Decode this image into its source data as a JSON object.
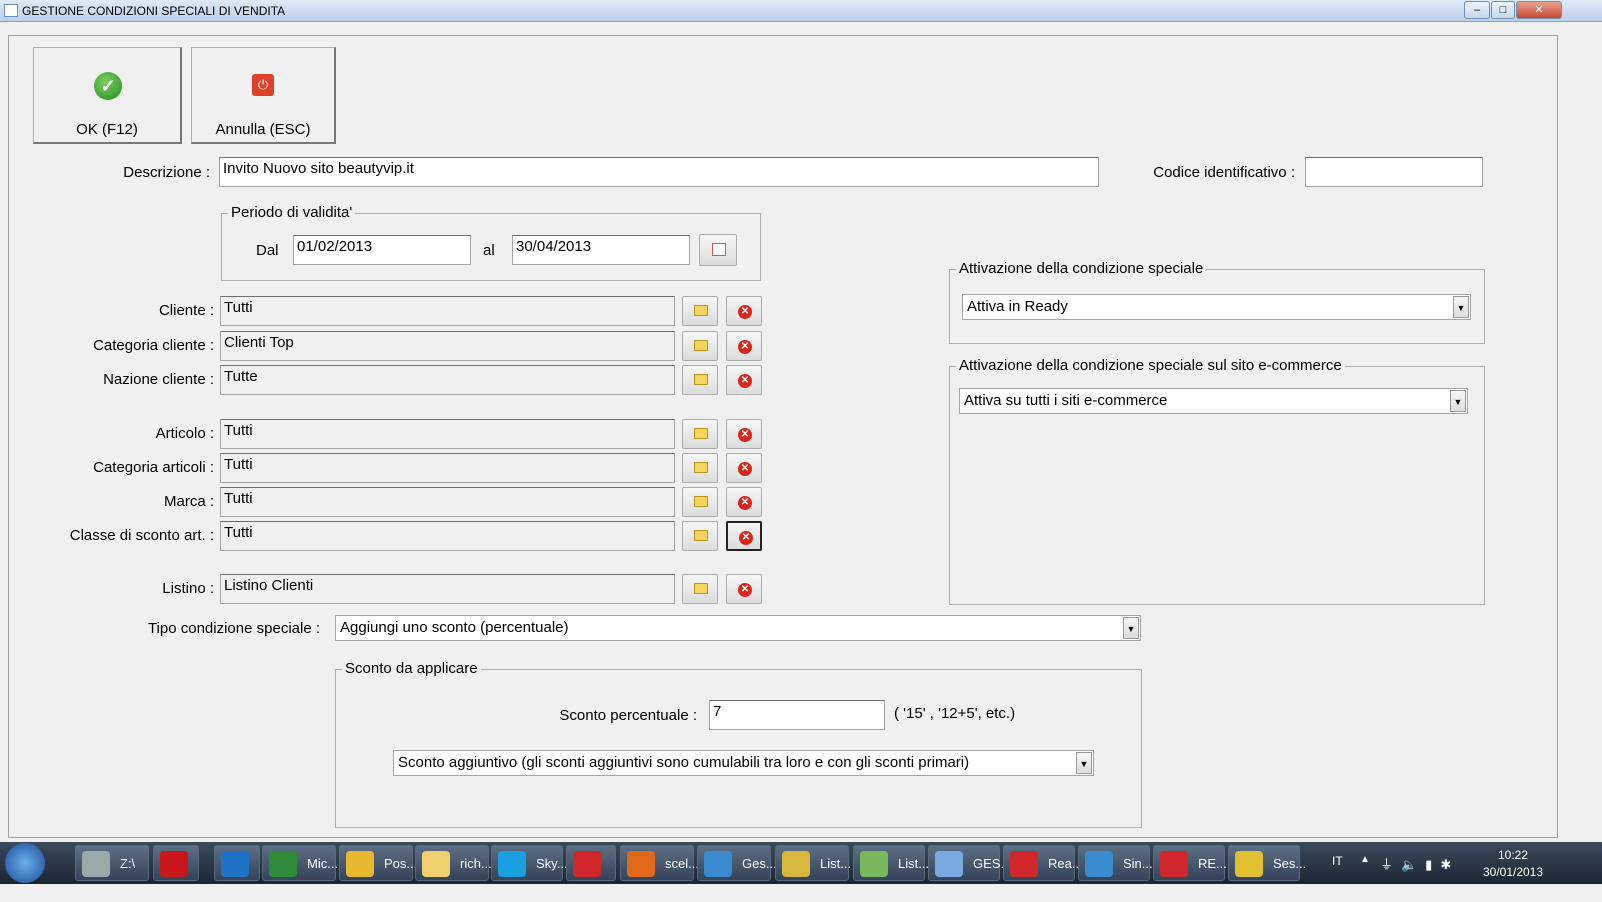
{
  "window": {
    "title": "GESTIONE CONDIZIONI SPECIALI DI VENDITA"
  },
  "toolbar": {
    "ok_label": "OK (F12)",
    "cancel_label": "Annulla (ESC)"
  },
  "form": {
    "descrizione_label": "Descrizione :",
    "descrizione_value": "Invito Nuovo sito beautyvip.it",
    "codice_label": "Codice identificativo :",
    "codice_value": "",
    "periodo_caption": "Periodo di validita'",
    "dal_label": "Dal",
    "dal_value": "01/02/2013",
    "al_label": "al",
    "al_value": "30/04/2013",
    "rows": [
      {
        "label": "Cliente :",
        "value": "Tutti"
      },
      {
        "label": "Categoria cliente :",
        "value": "Clienti Top"
      },
      {
        "label": "Nazione cliente :",
        "value": "Tutte"
      },
      {
        "label": "Articolo :",
        "value": "Tutti"
      },
      {
        "label": "Categoria articoli :",
        "value": "Tutti"
      },
      {
        "label": "Marca :",
        "value": "Tutti"
      },
      {
        "label": "Classe di sconto art. :",
        "value": "Tutti"
      },
      {
        "label": "Listino :",
        "value": "Listino Clienti"
      }
    ],
    "tipo_label": "Tipo condizione speciale :",
    "tipo_value": "Aggiungi uno sconto (percentuale)",
    "sconto_caption": "Sconto da applicare",
    "sconto_label": "Sconto percentuale :",
    "sconto_value": "7",
    "sconto_hint": "( '15' ,  '12+5', etc.)",
    "sconto_tipo_value": "Sconto aggiuntivo (gli sconti aggiuntivi sono cumulabili tra loro e con gli sconti primari)",
    "attivazione_caption": "Attivazione della condizione speciale",
    "attivazione_value": "Attiva in Ready",
    "ecommerce_caption": "Attivazione della condizione speciale sul sito e-commerce",
    "ecommerce_value": "Attiva su tutti i siti e-commerce"
  },
  "taskbar": {
    "items": [
      {
        "label": "Z:\\",
        "color": "#9aa"
      },
      {
        "label": "",
        "color": "#c8161d"
      },
      {
        "label": "",
        "color": "#1e73c8"
      },
      {
        "label": "Mic...",
        "color": "#2e8b3a"
      },
      {
        "label": "Pos...",
        "color": "#e8b830"
      },
      {
        "label": "rich...",
        "color": "#f0d070"
      },
      {
        "label": "Sky...",
        "color": "#1aa0e0"
      },
      {
        "label": "",
        "color": "#d0282a"
      },
      {
        "label": "scel...",
        "color": "#e06a1a"
      },
      {
        "label": "Ges...",
        "color": "#3a8ad0"
      },
      {
        "label": "List...",
        "color": "#d8b840"
      },
      {
        "label": "List...",
        "color": "#7ab860"
      },
      {
        "label": "GES...",
        "color": "#7aa8e0"
      },
      {
        "label": "Rea...",
        "color": "#d0282a"
      },
      {
        "label": "Sin...",
        "color": "#3a8ad0"
      },
      {
        "label": "RE...",
        "color": "#d0282a"
      },
      {
        "label": "Ses...",
        "color": "#e0c030"
      }
    ],
    "lang": "IT",
    "time": "10:22",
    "date": "30/01/2013"
  }
}
